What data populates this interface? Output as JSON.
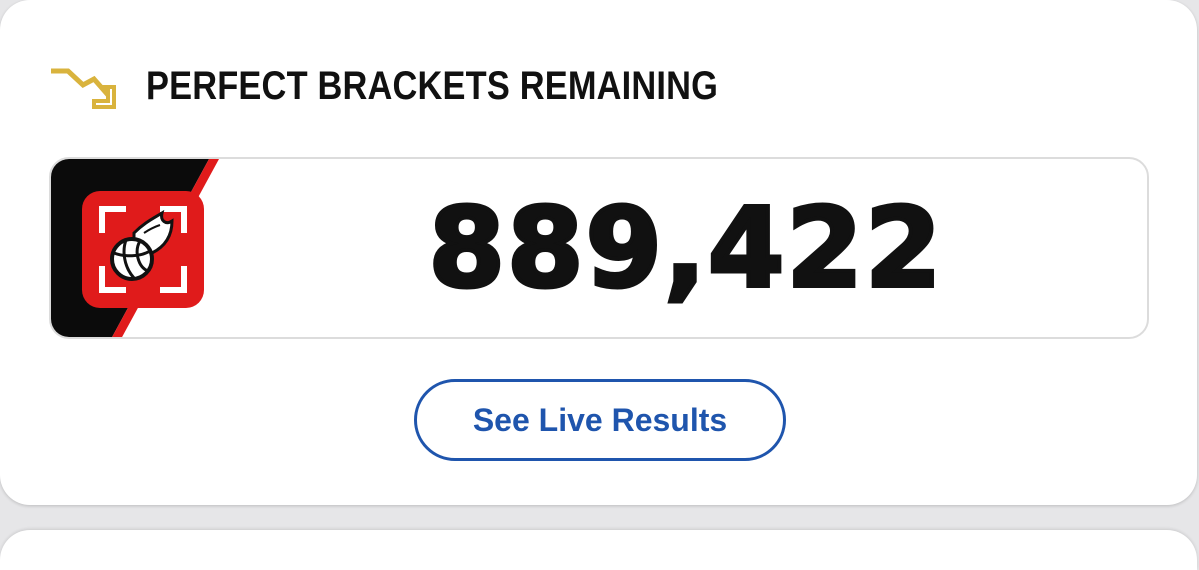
{
  "header": {
    "icon": "trending-down-icon",
    "title": "PERFECT BRACKETS REMAINING"
  },
  "counter": {
    "value": "889,422",
    "badge_icon": "flaming-basketball-icon"
  },
  "actions": {
    "see_results_label": "See Live Results"
  },
  "colors": {
    "accent_gold": "#d9b33d",
    "badge_red": "#e01b1b",
    "badge_black": "#0b0b0b",
    "button_blue": "#1f55ad"
  }
}
